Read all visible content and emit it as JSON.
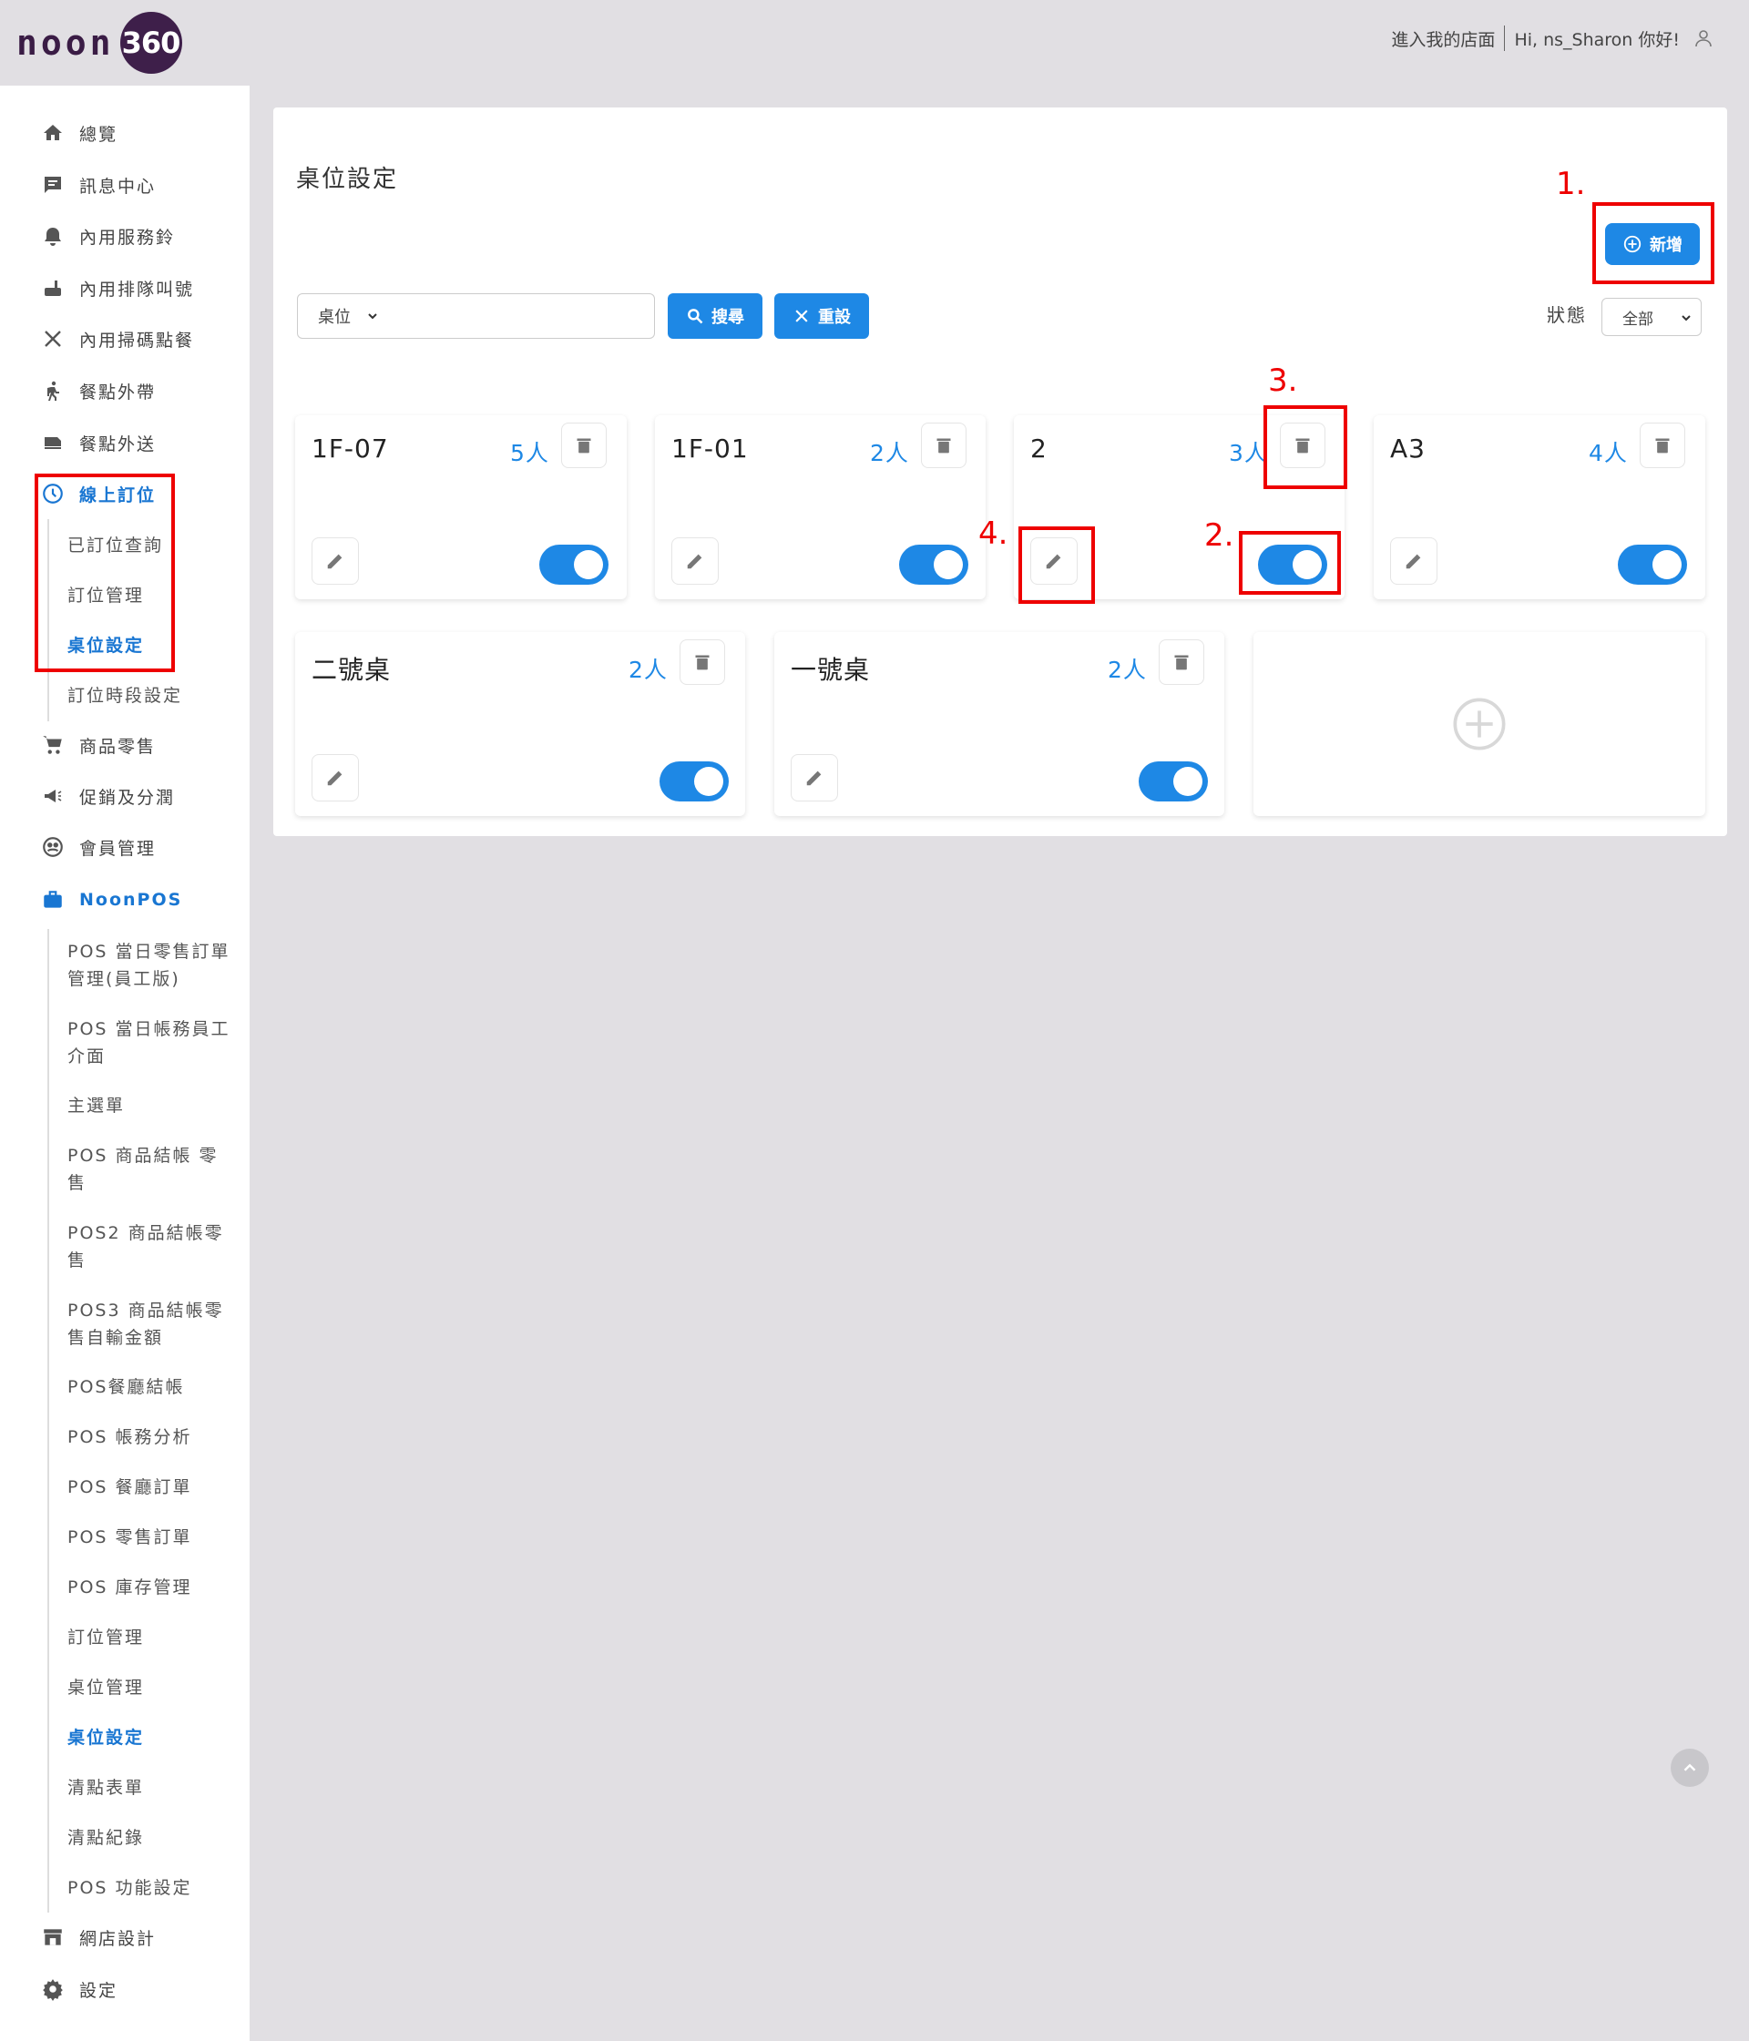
{
  "header": {
    "logo_text": "noon",
    "logo_badge": "360",
    "enter_store": "進入我的店面",
    "greeting": "Hi, ns_Sharon 你好!"
  },
  "sidebar": {
    "items": [
      {
        "label": "總覽",
        "icon": "home-icon"
      },
      {
        "label": "訊息中心",
        "icon": "message-icon"
      },
      {
        "label": "內用服務鈴",
        "icon": "bell-icon"
      },
      {
        "label": "內用排隊叫號",
        "icon": "queue-icon"
      },
      {
        "label": "內用掃碼點餐",
        "icon": "utensils-icon"
      },
      {
        "label": "餐點外帶",
        "icon": "walk-icon"
      },
      {
        "label": "餐點外送",
        "icon": "delivery-icon"
      },
      {
        "label": "線上訂位",
        "icon": "clock-icon"
      },
      {
        "label": "商品零售",
        "icon": "cart-icon"
      },
      {
        "label": "促銷及分潤",
        "icon": "megaphone-icon"
      },
      {
        "label": "會員管理",
        "icon": "members-icon"
      },
      {
        "label": "NoonPOS",
        "icon": "briefcase-icon"
      },
      {
        "label": "網店設計",
        "icon": "store-icon"
      },
      {
        "label": "設定",
        "icon": "gear-icon"
      }
    ],
    "booking_sub": [
      "已訂位查詢",
      "訂位管理",
      "桌位設定",
      "訂位時段設定"
    ],
    "pos_sub": [
      "POS 當日零售訂單管理(員工版)",
      "POS 當日帳務員工介面",
      "主選單",
      "POS 商品結帳 零售",
      "POS2 商品結帳零售",
      "POS3 商品結帳零售自輸金額",
      "POS餐廳結帳",
      "POS 帳務分析",
      "POS 餐廳訂單",
      "POS 零售訂單",
      "POS 庫存管理",
      "訂位管理",
      "桌位管理",
      "桌位設定",
      "清點表單",
      "清點紀錄",
      "POS 功能設定"
    ]
  },
  "main": {
    "title": "桌位設定",
    "add_label": "新增",
    "search_field": "桌位",
    "search_input_value": "",
    "search_label": "搜尋",
    "reset_label": "重設",
    "status_label": "狀態",
    "status_value": "全部"
  },
  "tables": [
    {
      "name": "1F-07",
      "capacity": "5人",
      "enabled": true
    },
    {
      "name": "1F-01",
      "capacity": "2人",
      "enabled": true
    },
    {
      "name": "2",
      "capacity": "3人",
      "enabled": true
    },
    {
      "name": "A3",
      "capacity": "4人",
      "enabled": true
    },
    {
      "name": "二號桌",
      "capacity": "2人",
      "enabled": true
    },
    {
      "name": "一號桌",
      "capacity": "2人",
      "enabled": true
    }
  ],
  "annotations": [
    "1.",
    "2.",
    "3.",
    "4."
  ],
  "colors": {
    "accent": "#1e88e5",
    "annotation": "#e00000",
    "brand": "#3e1f4a"
  }
}
